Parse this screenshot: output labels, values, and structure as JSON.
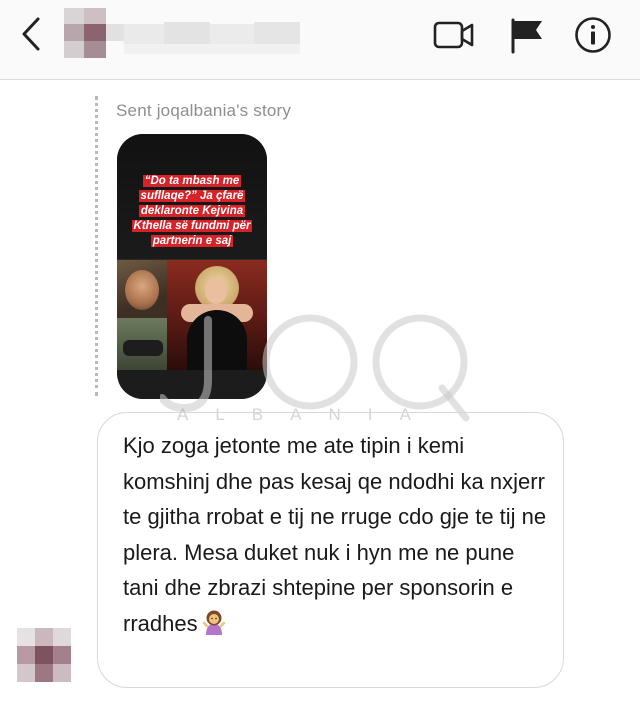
{
  "header": {
    "back_icon": "chevron-left-icon",
    "contact_name": "",
    "video_icon": "video-camera-icon",
    "flag_icon": "flag-icon",
    "info_icon": "info-icon"
  },
  "story_reply": {
    "label": "Sent joqalbania's story",
    "headline": "“Do ta mbash me sufllaqe?” Ja çfarë deklaronte Kejvina Kthella së fundmi për partnerin e saj"
  },
  "watermark": {
    "text": "ALBANIA"
  },
  "message": {
    "text": "Kjo zoga jetonte me ate tipin i kemi komshinj dhe pas kesaj qe ndodhi ka nxjerr te gjitha rrobat e tij ne rruge cdo gje te tij ne plera. Mesa duket nuk i hyn me ne pune tani dhe zbrazi shtepine per sponsorin e rradhes",
    "emoji": "person-shrugging-emoji"
  },
  "colors": {
    "header_bg": "#fafafa",
    "bubble_border": "#d8d8d8",
    "label_gray": "#8e8e8e",
    "headline_red": "#d6232a"
  }
}
